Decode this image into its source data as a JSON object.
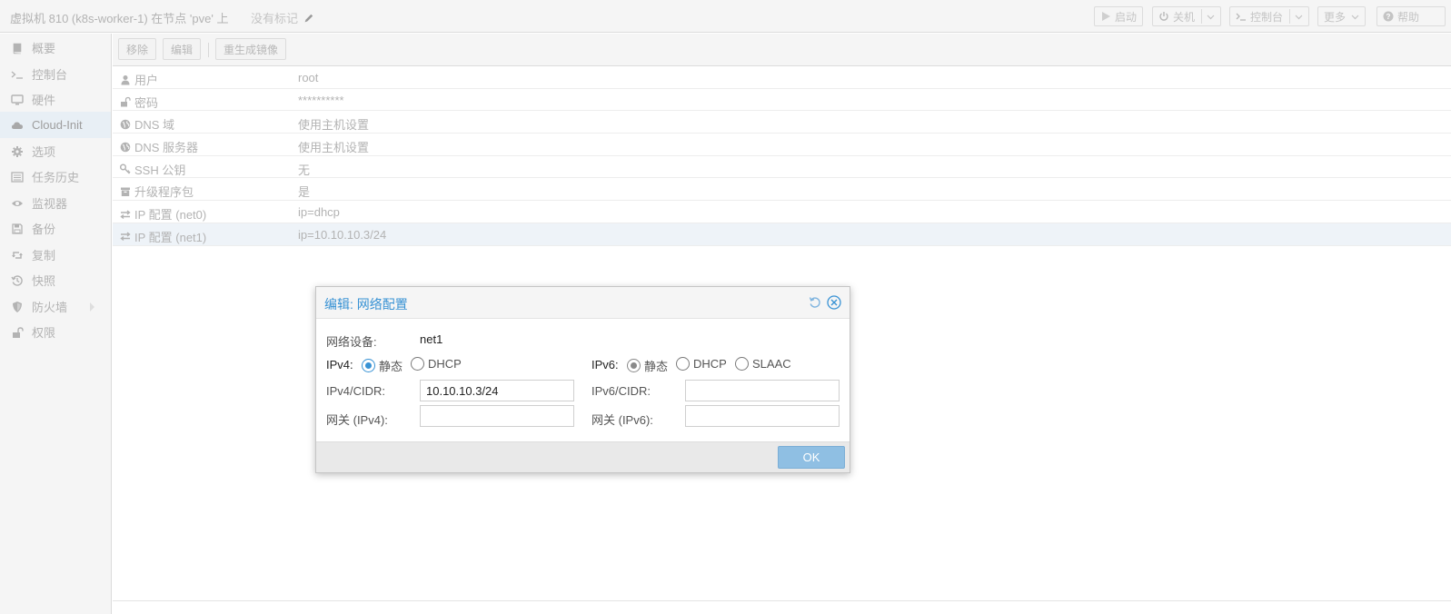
{
  "header": {
    "title": "虚拟机 810 (k8s-worker-1) 在节点 'pve' 上",
    "tags_label": "没有标记",
    "buttons": {
      "start": "启动",
      "shutdown": "关机",
      "console": "控制台",
      "more": "更多",
      "help": "帮助"
    }
  },
  "sidebar": {
    "items": [
      {
        "label": "概要",
        "icon": "book-icon"
      },
      {
        "label": "控制台",
        "icon": "terminal-icon"
      },
      {
        "label": "硬件",
        "icon": "desktop-icon"
      },
      {
        "label": "Cloud-Init",
        "icon": "cloud-icon",
        "active": true
      },
      {
        "label": "选项",
        "icon": "gear-icon"
      },
      {
        "label": "任务历史",
        "icon": "list-icon"
      },
      {
        "label": "监视器",
        "icon": "eye-icon"
      },
      {
        "label": "备份",
        "icon": "floppy-icon"
      },
      {
        "label": "复制",
        "icon": "retweet-icon"
      },
      {
        "label": "快照",
        "icon": "history-icon"
      },
      {
        "label": "防火墙",
        "icon": "shield-icon"
      },
      {
        "label": "权限",
        "icon": "unlock-icon"
      }
    ]
  },
  "toolbar": {
    "remove": "移除",
    "edit": "编辑",
    "regenerate": "重生成镜像"
  },
  "grid": {
    "rows": [
      {
        "key": "用户",
        "value": "root",
        "icon": "user-icon"
      },
      {
        "key": "密码",
        "value": "**********",
        "icon": "unlock-icon"
      },
      {
        "key": "DNS 域",
        "value": "使用主机设置",
        "icon": "globe-icon"
      },
      {
        "key": "DNS 服务器",
        "value": "使用主机设置",
        "icon": "globe-icon"
      },
      {
        "key": "SSH 公钥",
        "value": "无",
        "icon": "key-icon"
      },
      {
        "key": "升级程序包",
        "value": "是",
        "icon": "archive-icon"
      },
      {
        "key": "IP 配置 (net0)",
        "value": "ip=dhcp",
        "icon": "exchange-icon"
      },
      {
        "key": "IP 配置 (net1)",
        "value": "ip=10.10.10.3/24",
        "icon": "exchange-icon",
        "selected": true
      }
    ]
  },
  "dialog": {
    "title": "编辑: 网络配置",
    "device_label": "网络设备:",
    "device_value": "net1",
    "ipv4_label": "IPv4:",
    "ipv4_options": [
      "静态",
      "DHCP"
    ],
    "ipv4_selected": "静态",
    "ipv6_label": "IPv6:",
    "ipv6_options": [
      "静态",
      "DHCP",
      "SLAAC"
    ],
    "ipv6_selected": "静态",
    "ipv4_cidr_label": "IPv4/CIDR:",
    "ipv4_cidr_value": "10.10.10.3/24",
    "ipv6_cidr_label": "IPv6/CIDR:",
    "ipv6_cidr_value": "",
    "gw4_label": "网关 (IPv4):",
    "gw4_value": "",
    "gw6_label": "网关 (IPv6):",
    "gw6_value": "",
    "ok": "OK"
  },
  "colors": {
    "accent": "#3892d4",
    "ok_button": "#8fbfe3",
    "muted_text": "#b3b3b3",
    "selected_row": "#eef3f8"
  }
}
